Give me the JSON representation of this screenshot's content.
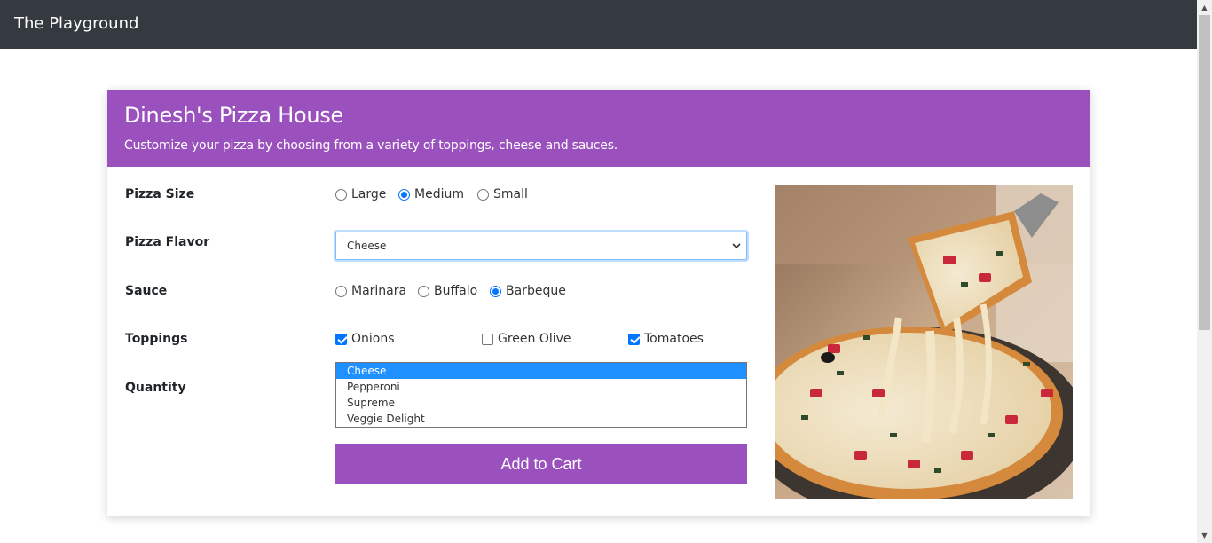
{
  "navbar": {
    "brand": "The Playground"
  },
  "card": {
    "title": "Dinesh's Pizza House",
    "subtitle": "Customize your pizza by choosing from a variety of toppings, cheese and sauces."
  },
  "form": {
    "size": {
      "label": "Pizza Size",
      "options": [
        {
          "label": "Large",
          "checked": false
        },
        {
          "label": "Medium",
          "checked": true
        },
        {
          "label": "Small",
          "checked": false
        }
      ]
    },
    "flavor": {
      "label": "Pizza Flavor",
      "selected": "Cheese"
    },
    "sauce": {
      "label": "Sauce",
      "options": [
        {
          "label": "Marinara",
          "checked": false
        },
        {
          "label": "Buffalo",
          "checked": false
        },
        {
          "label": "Barbeque",
          "checked": true
        }
      ]
    },
    "toppings": {
      "label": "Toppings",
      "options": [
        {
          "label": "Onions",
          "checked": true
        },
        {
          "label": "Green Olive",
          "checked": false
        },
        {
          "label": "Tomatoes",
          "checked": true
        }
      ]
    },
    "quantity": {
      "label": "Quantity",
      "items": [
        {
          "label": "Cheese",
          "selected": true
        },
        {
          "label": "Pepperoni",
          "selected": false
        },
        {
          "label": "Supreme",
          "selected": false
        },
        {
          "label": "Veggie Delight",
          "selected": false
        }
      ]
    },
    "add_to_cart": "Add to Cart"
  },
  "colors": {
    "navbar": "#343a40",
    "accent": "#9b51bd",
    "check": "#0075ff",
    "list_selected": "#1e90ff"
  }
}
